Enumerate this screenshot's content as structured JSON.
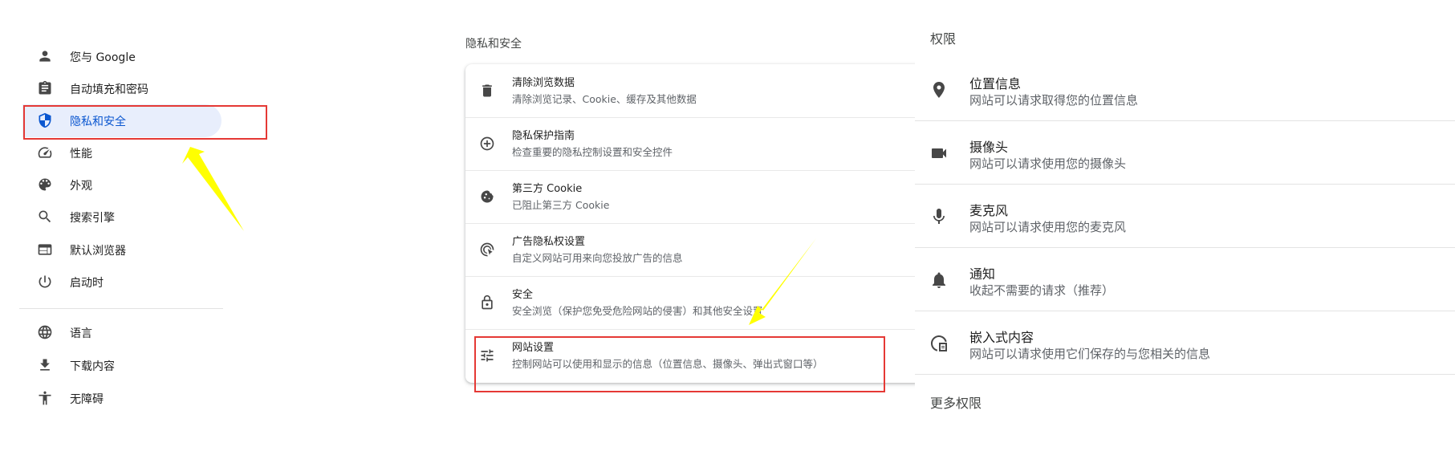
{
  "sidebar": {
    "items": [
      {
        "label": "您与 Google",
        "icon": "person-icon",
        "active": false
      },
      {
        "label": "自动填充和密码",
        "icon": "clipboard-icon",
        "active": false
      },
      {
        "label": "隐私和安全",
        "icon": "shield-icon",
        "active": true
      },
      {
        "label": "性能",
        "icon": "speedometer-icon",
        "active": false
      },
      {
        "label": "外观",
        "icon": "palette-icon",
        "active": false
      },
      {
        "label": "搜索引擎",
        "icon": "search-icon",
        "active": false
      },
      {
        "label": "默认浏览器",
        "icon": "browser-icon",
        "active": false
      },
      {
        "label": "启动时",
        "icon": "power-icon",
        "active": false
      },
      {
        "label": "语言",
        "icon": "globe-icon",
        "active": false
      },
      {
        "label": "下载内容",
        "icon": "download-icon",
        "active": false
      },
      {
        "label": "无障碍",
        "icon": "accessibility-icon",
        "active": false
      }
    ]
  },
  "privacy": {
    "section_title": "隐私和安全",
    "rows": [
      {
        "title": "清除浏览数据",
        "desc": "清除浏览记录、Cookie、缓存及其他数据",
        "icon": "trash-icon"
      },
      {
        "title": "隐私保护指南",
        "desc": "检查重要的隐私控制设置和安全控件",
        "icon": "compass-icon"
      },
      {
        "title": "第三方 Cookie",
        "desc": "已阻止第三方 Cookie",
        "icon": "cookie-icon"
      },
      {
        "title": "广告隐私权设置",
        "desc": "自定义网站可用来向您投放广告的信息",
        "icon": "ad-privacy-icon"
      },
      {
        "title": "安全",
        "desc": "安全浏览（保护您免受危险网站的侵害）和其他安全设置",
        "icon": "lock-icon"
      },
      {
        "title": "网站设置",
        "desc": "控制网站可以使用和显示的信息（位置信息、摄像头、弹出式窗口等）",
        "icon": "tune-icon"
      }
    ]
  },
  "permissions": {
    "heading": "权限",
    "rows": [
      {
        "title": "位置信息",
        "desc": "网站可以请求取得您的位置信息",
        "icon": "location-pin-icon"
      },
      {
        "title": "摄像头",
        "desc": "网站可以请求使用您的摄像头",
        "icon": "video-camera-icon"
      },
      {
        "title": "麦克风",
        "desc": "网站可以请求使用您的麦克风",
        "icon": "microphone-icon"
      },
      {
        "title": "通知",
        "desc": "收起不需要的请求（推荐）",
        "icon": "bell-icon"
      },
      {
        "title": "嵌入式内容",
        "desc": "网站可以请求使用它们保存的与您相关的信息",
        "icon": "embedded-content-icon"
      }
    ],
    "more_label": "更多权限"
  },
  "colors": {
    "active_bg": "#e8eefc",
    "active_text": "#0b57d0",
    "annotation_box": "#e53935",
    "annotation_arrow": "#ffff00"
  }
}
